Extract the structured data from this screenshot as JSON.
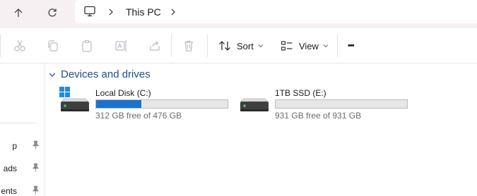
{
  "address": {
    "breadcrumb": "This PC"
  },
  "toolbar": {
    "sort_label": "Sort",
    "view_label": "View",
    "more_label": "•••"
  },
  "sidebar": {
    "items": [
      {
        "label": "p",
        "pinned": true
      },
      {
        "label": "ads",
        "pinned": true
      },
      {
        "label": "ents",
        "pinned": true
      }
    ]
  },
  "section": {
    "title": "Devices and drives"
  },
  "drives": [
    {
      "name": "Local Disk (C:)",
      "free_text": "312 GB free of 476 GB",
      "used_fraction": 0.345,
      "has_windows_logo": true
    },
    {
      "name": "1TB SSD (E:)",
      "free_text": "931 GB free of 931 GB",
      "used_fraction": 0.0,
      "has_windows_logo": false
    }
  ],
  "colors": {
    "accent": "#1a73cf",
    "section_title": "#1f4e8c",
    "topbar_bg": "#f7f0f2"
  }
}
